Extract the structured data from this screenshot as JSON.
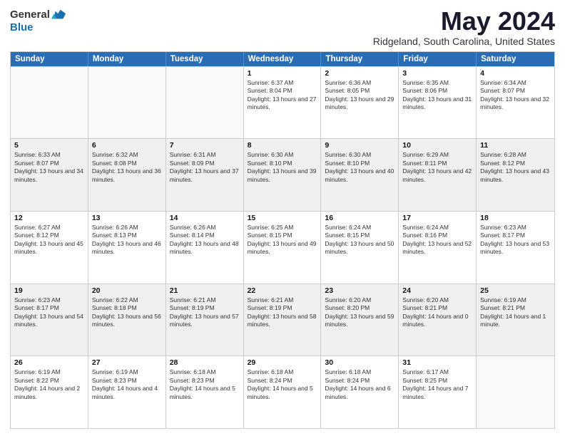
{
  "header": {
    "logo_general": "General",
    "logo_blue": "Blue",
    "month_title": "May 2024",
    "location": "Ridgeland, South Carolina, United States"
  },
  "calendar": {
    "days_of_week": [
      "Sunday",
      "Monday",
      "Tuesday",
      "Wednesday",
      "Thursday",
      "Friday",
      "Saturday"
    ],
    "weeks": [
      [
        {
          "day": "",
          "sunrise": "",
          "sunset": "",
          "daylight": "",
          "empty": true
        },
        {
          "day": "",
          "sunrise": "",
          "sunset": "",
          "daylight": "",
          "empty": true
        },
        {
          "day": "",
          "sunrise": "",
          "sunset": "",
          "daylight": "",
          "empty": true
        },
        {
          "day": "1",
          "sunrise": "Sunrise: 6:37 AM",
          "sunset": "Sunset: 8:04 PM",
          "daylight": "Daylight: 13 hours and 27 minutes.",
          "empty": false
        },
        {
          "day": "2",
          "sunrise": "Sunrise: 6:36 AM",
          "sunset": "Sunset: 8:05 PM",
          "daylight": "Daylight: 13 hours and 29 minutes.",
          "empty": false
        },
        {
          "day": "3",
          "sunrise": "Sunrise: 6:35 AM",
          "sunset": "Sunset: 8:06 PM",
          "daylight": "Daylight: 13 hours and 31 minutes.",
          "empty": false
        },
        {
          "day": "4",
          "sunrise": "Sunrise: 6:34 AM",
          "sunset": "Sunset: 8:07 PM",
          "daylight": "Daylight: 13 hours and 32 minutes.",
          "empty": false
        }
      ],
      [
        {
          "day": "5",
          "sunrise": "Sunrise: 6:33 AM",
          "sunset": "Sunset: 8:07 PM",
          "daylight": "Daylight: 13 hours and 34 minutes.",
          "empty": false
        },
        {
          "day": "6",
          "sunrise": "Sunrise: 6:32 AM",
          "sunset": "Sunset: 8:08 PM",
          "daylight": "Daylight: 13 hours and 36 minutes.",
          "empty": false
        },
        {
          "day": "7",
          "sunrise": "Sunrise: 6:31 AM",
          "sunset": "Sunset: 8:09 PM",
          "daylight": "Daylight: 13 hours and 37 minutes.",
          "empty": false
        },
        {
          "day": "8",
          "sunrise": "Sunrise: 6:30 AM",
          "sunset": "Sunset: 8:10 PM",
          "daylight": "Daylight: 13 hours and 39 minutes.",
          "empty": false
        },
        {
          "day": "9",
          "sunrise": "Sunrise: 6:30 AM",
          "sunset": "Sunset: 8:10 PM",
          "daylight": "Daylight: 13 hours and 40 minutes.",
          "empty": false
        },
        {
          "day": "10",
          "sunrise": "Sunrise: 6:29 AM",
          "sunset": "Sunset: 8:11 PM",
          "daylight": "Daylight: 13 hours and 42 minutes.",
          "empty": false
        },
        {
          "day": "11",
          "sunrise": "Sunrise: 6:28 AM",
          "sunset": "Sunset: 8:12 PM",
          "daylight": "Daylight: 13 hours and 43 minutes.",
          "empty": false
        }
      ],
      [
        {
          "day": "12",
          "sunrise": "Sunrise: 6:27 AM",
          "sunset": "Sunset: 8:12 PM",
          "daylight": "Daylight: 13 hours and 45 minutes.",
          "empty": false
        },
        {
          "day": "13",
          "sunrise": "Sunrise: 6:26 AM",
          "sunset": "Sunset: 8:13 PM",
          "daylight": "Daylight: 13 hours and 46 minutes.",
          "empty": false
        },
        {
          "day": "14",
          "sunrise": "Sunrise: 6:26 AM",
          "sunset": "Sunset: 8:14 PM",
          "daylight": "Daylight: 13 hours and 48 minutes.",
          "empty": false
        },
        {
          "day": "15",
          "sunrise": "Sunrise: 6:25 AM",
          "sunset": "Sunset: 8:15 PM",
          "daylight": "Daylight: 13 hours and 49 minutes.",
          "empty": false
        },
        {
          "day": "16",
          "sunrise": "Sunrise: 6:24 AM",
          "sunset": "Sunset: 8:15 PM",
          "daylight": "Daylight: 13 hours and 50 minutes.",
          "empty": false
        },
        {
          "day": "17",
          "sunrise": "Sunrise: 6:24 AM",
          "sunset": "Sunset: 8:16 PM",
          "daylight": "Daylight: 13 hours and 52 minutes.",
          "empty": false
        },
        {
          "day": "18",
          "sunrise": "Sunrise: 6:23 AM",
          "sunset": "Sunset: 8:17 PM",
          "daylight": "Daylight: 13 hours and 53 minutes.",
          "empty": false
        }
      ],
      [
        {
          "day": "19",
          "sunrise": "Sunrise: 6:23 AM",
          "sunset": "Sunset: 8:17 PM",
          "daylight": "Daylight: 13 hours and 54 minutes.",
          "empty": false
        },
        {
          "day": "20",
          "sunrise": "Sunrise: 6:22 AM",
          "sunset": "Sunset: 8:18 PM",
          "daylight": "Daylight: 13 hours and 56 minutes.",
          "empty": false
        },
        {
          "day": "21",
          "sunrise": "Sunrise: 6:21 AM",
          "sunset": "Sunset: 8:19 PM",
          "daylight": "Daylight: 13 hours and 57 minutes.",
          "empty": false
        },
        {
          "day": "22",
          "sunrise": "Sunrise: 6:21 AM",
          "sunset": "Sunset: 8:19 PM",
          "daylight": "Daylight: 13 hours and 58 minutes.",
          "empty": false
        },
        {
          "day": "23",
          "sunrise": "Sunrise: 6:20 AM",
          "sunset": "Sunset: 8:20 PM",
          "daylight": "Daylight: 13 hours and 59 minutes.",
          "empty": false
        },
        {
          "day": "24",
          "sunrise": "Sunrise: 6:20 AM",
          "sunset": "Sunset: 8:21 PM",
          "daylight": "Daylight: 14 hours and 0 minutes.",
          "empty": false
        },
        {
          "day": "25",
          "sunrise": "Sunrise: 6:19 AM",
          "sunset": "Sunset: 8:21 PM",
          "daylight": "Daylight: 14 hours and 1 minute.",
          "empty": false
        }
      ],
      [
        {
          "day": "26",
          "sunrise": "Sunrise: 6:19 AM",
          "sunset": "Sunset: 8:22 PM",
          "daylight": "Daylight: 14 hours and 2 minutes.",
          "empty": false
        },
        {
          "day": "27",
          "sunrise": "Sunrise: 6:19 AM",
          "sunset": "Sunset: 8:23 PM",
          "daylight": "Daylight: 14 hours and 4 minutes.",
          "empty": false
        },
        {
          "day": "28",
          "sunrise": "Sunrise: 6:18 AM",
          "sunset": "Sunset: 8:23 PM",
          "daylight": "Daylight: 14 hours and 5 minutes.",
          "empty": false
        },
        {
          "day": "29",
          "sunrise": "Sunrise: 6:18 AM",
          "sunset": "Sunset: 8:24 PM",
          "daylight": "Daylight: 14 hours and 5 minutes.",
          "empty": false
        },
        {
          "day": "30",
          "sunrise": "Sunrise: 6:18 AM",
          "sunset": "Sunset: 8:24 PM",
          "daylight": "Daylight: 14 hours and 6 minutes.",
          "empty": false
        },
        {
          "day": "31",
          "sunrise": "Sunrise: 6:17 AM",
          "sunset": "Sunset: 8:25 PM",
          "daylight": "Daylight: 14 hours and 7 minutes.",
          "empty": false
        },
        {
          "day": "",
          "sunrise": "",
          "sunset": "",
          "daylight": "",
          "empty": true
        }
      ]
    ]
  }
}
